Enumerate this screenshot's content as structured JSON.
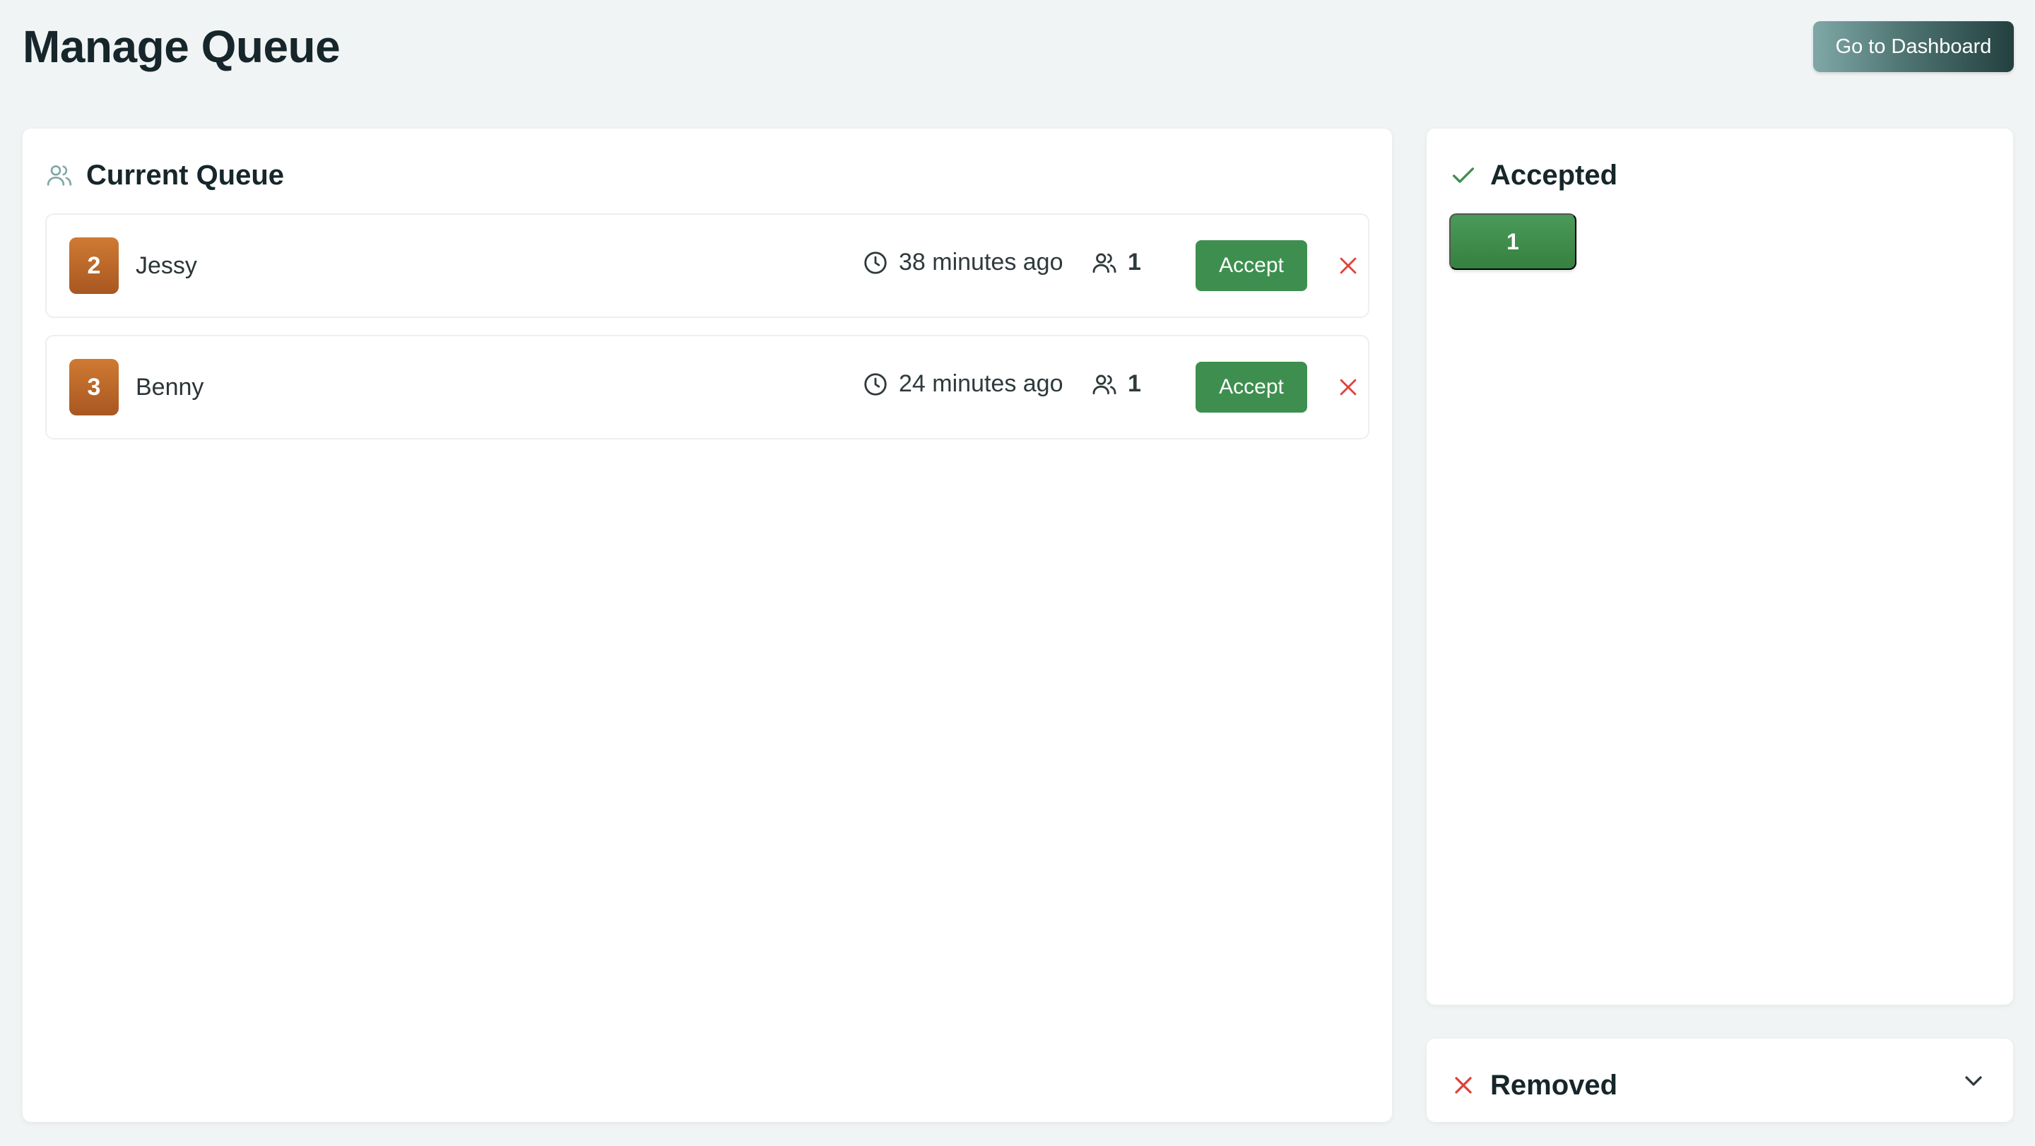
{
  "header": {
    "title": "Manage Queue",
    "dashboard_button": "Go to Dashboard"
  },
  "queue": {
    "title": "Current Queue",
    "icon": "users-icon",
    "rows": [
      {
        "number": "2",
        "name": "Jessy",
        "time": "38 minutes ago",
        "party_size": "1",
        "accept_label": "Accept"
      },
      {
        "number": "3",
        "name": "Benny",
        "time": "24 minutes ago",
        "party_size": "1",
        "accept_label": "Accept"
      }
    ]
  },
  "accepted": {
    "title": "Accepted",
    "icon": "check-icon",
    "items": [
      "1"
    ]
  },
  "removed": {
    "title": "Removed",
    "icon": "x-icon",
    "toggle_icon": "chevron-down-icon"
  },
  "colors": {
    "accent_green": "#3e8f4f",
    "badge_orange": "#c06a2a",
    "remove_red": "#e0413a",
    "dashboard_button": "#3f6563"
  }
}
